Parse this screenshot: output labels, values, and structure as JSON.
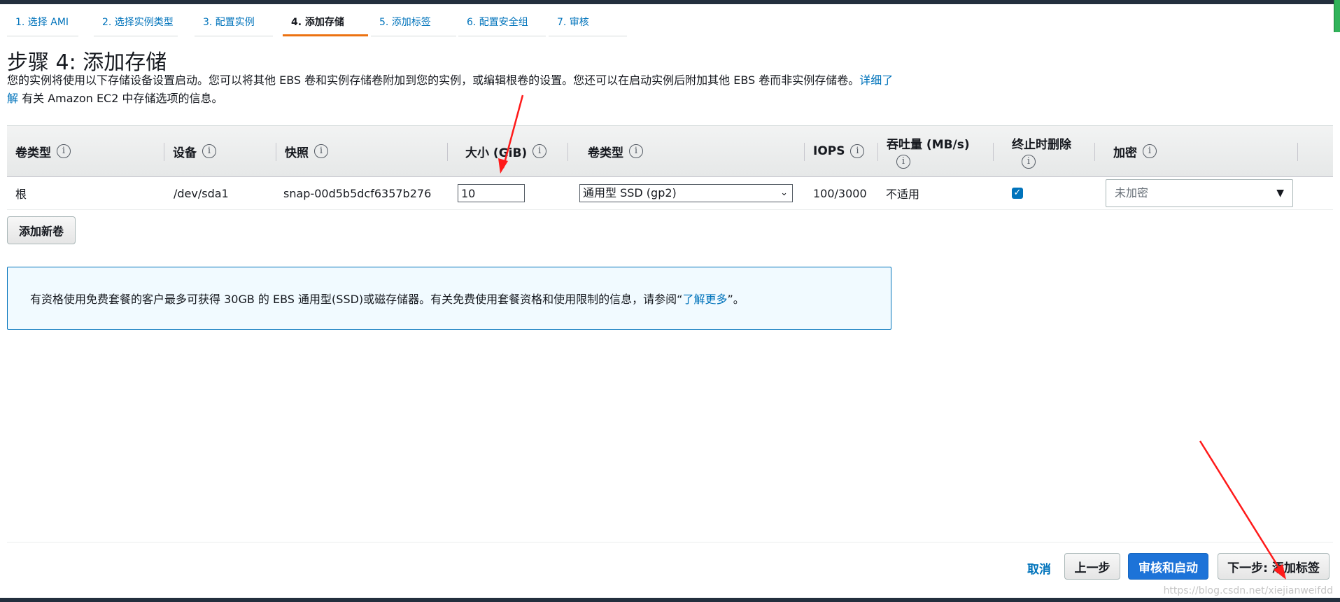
{
  "wizard": {
    "steps": [
      "1. 选择 AMI",
      "2. 选择实例类型",
      "3. 配置实例",
      "4. 添加存储",
      "5. 添加标签",
      "6. 配置安全组",
      "7. 审核"
    ],
    "active_step": 3
  },
  "page": {
    "title": "步骤 4: 添加存储",
    "desc_text": "您的实例将使用以下存储设备设置启动。您可以将其他 EBS 卷和实例存储卷附加到您的实例，或编辑根卷的设置。您还可以在启动实例后附加其他 EBS 卷而非实例存储卷。",
    "desc_link": "详细了解",
    "desc_tail": "有关 Amazon EC2 中存储选项的信息。"
  },
  "table": {
    "headers": {
      "volume_type": "卷类型",
      "device": "设备",
      "snapshot": "快照",
      "size": "大小 (GiB)",
      "volume_kind": "卷类型",
      "iops": "IOPS",
      "throughput": "吞吐量 (MB/s)",
      "delete_on_term": "终止时删除",
      "encryption": "加密"
    },
    "info_glyph": "i",
    "row": {
      "volume_type": "根",
      "device": "/dev/sda1",
      "snapshot": "snap-00d5b5dcf6357b276",
      "size": "10",
      "volume_kind": "通用型 SSD (gp2)",
      "iops": "100/3000",
      "throughput": "不适用",
      "delete_on_term": true,
      "encryption": "未加密"
    },
    "add_volume_label": "添加新卷"
  },
  "info_box": {
    "text": "有资格使用免费套餐的客户最多可获得 30GB 的 EBS 通用型(SSD)或磁存储器。有关免费使用套餐资格和使用限制的信息，请参阅“",
    "link": "了解更多",
    "tail": "”。"
  },
  "footer": {
    "cancel": "取消",
    "previous": "上一步",
    "review_launch": "审核和启动",
    "next": "下一步: 添加标签"
  },
  "watermark": "https://blog.csdn.net/xiejianweifdd",
  "colors": {
    "link": "#0073bb",
    "primary_button": "#1d73d8",
    "active_step_underline": "#ec7211",
    "annotation_arrow": "#ff1a1a"
  }
}
